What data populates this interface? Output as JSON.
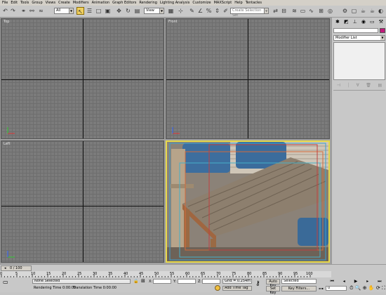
{
  "menu": [
    "File",
    "Edit",
    "Tools",
    "Group",
    "Views",
    "Create",
    "Modifiers",
    "Animation",
    "Graph Editors",
    "Rendering",
    "Lighting Analysis",
    "Customize",
    "MAXScript",
    "Help",
    "Tentacles"
  ],
  "toolbar": {
    "filter_value": "All",
    "refcoord_value": "View",
    "selection_set_placeholder": "Create Selection Set"
  },
  "viewports": {
    "top": "Top",
    "front": "Front",
    "left": "Left"
  },
  "command_panel": {
    "modifier_list": "Modifier List"
  },
  "timeline": {
    "slider_label": "0 / 100",
    "ticks": [
      "0",
      "5",
      "10",
      "15",
      "20",
      "25",
      "30",
      "35",
      "40",
      "45",
      "50",
      "55",
      "60",
      "65",
      "70",
      "75",
      "80",
      "85",
      "90",
      "95",
      "100"
    ]
  },
  "status": {
    "selection": "None Selected",
    "rendering_time": "Rendering Time  0:00:00",
    "translation_time": "Translation Time  0:00:00",
    "x_label": "X:",
    "y_label": "Y:",
    "z_label": "Z:",
    "grid": "Grid = 0.254m",
    "add_time_tag": "Add Time Tag",
    "auto_key": "Auto Key",
    "set_key": "Set Key",
    "key_mode_value": "Selected",
    "key_filters": "Key Filters...",
    "frame_value": "0"
  },
  "colors": {
    "active_viewport_border": "#e6d84a",
    "color_swatch": "#c2187a"
  }
}
